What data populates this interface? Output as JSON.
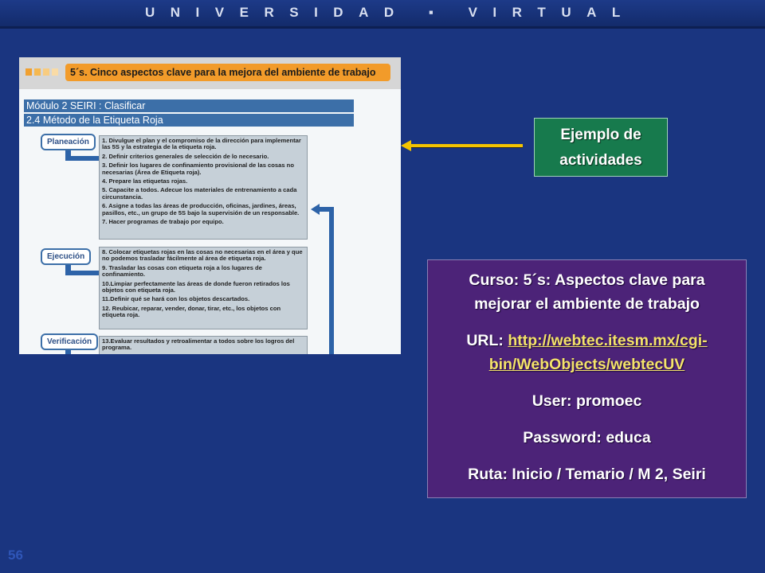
{
  "header": {
    "title": "UNIVERSIDAD ▪ VIRTUAL"
  },
  "slide_number": "56",
  "screenshot": {
    "banner": "5´s. Cinco aspectos clave para la mejora del ambiente de trabajo",
    "module": "Módulo 2 SEIRI : Clasificar",
    "section": "2.4 Método de la Etiqueta Roja",
    "phases": [
      {
        "label": "Planeación",
        "items": [
          "1. Divulgue el plan y el compromiso de la dirección para implementar las 5S y la estrategia de la etiqueta roja.",
          "2. Definir criterios generales de selección de lo necesario.",
          "3. Definir los lugares de confinamiento provisional de las cosas no necesarias (Área de Etiqueta roja).",
          "4. Prepare las etiquetas rojas.",
          "5. Capacite a todos.  Adecue los materiales de entrenamiento a cada circunstancia.",
          "6. Asigne a todas las áreas de producción, oficinas, jardines, áreas, pasillos, etc., un grupo de 5S bajo la supervisión de un responsable.",
          "7. Hacer programas de trabajo por equipo."
        ]
      },
      {
        "label": "Ejecución",
        "items": [
          "8. Colocar etiquetas rojas en las cosas no necesarias en el área y que no podemos trasladar fácilmente al área de etiqueta roja.",
          "9. Trasladar las cosas con etiqueta roja a los lugares de confinamiento.",
          "10.Limpiar perfectamente las áreas de donde fueron retirados los objetos con etiqueta roja.",
          "11.Definir qué se hará con los objetos descartados.",
          "12. Reubicar, reparar, vender, donar, tirar, etc., los objetos con etiqueta roja."
        ]
      },
      {
        "label": "Verificación",
        "items": [
          "13.Evaluar resultados y retroalimentar a todos sobre los logros del programa."
        ]
      }
    ]
  },
  "callout": {
    "line1": "Ejemplo de",
    "line2": "actividades"
  },
  "info": {
    "course_line1": "Curso: 5´s: Aspectos clave para",
    "course_line2": "mejorar el ambiente de trabajo",
    "url_label": "URL: ",
    "url_part1": "http://webtec.itesm.mx/cgi-",
    "url_part2": "bin/WebObjects/webtecUV",
    "user": "User: promoec",
    "password": "Password: educa",
    "route": "Ruta: Inicio / Temario / M 2, Seiri"
  },
  "colors": {
    "background": "#1a3580",
    "callout": "#177a4d",
    "info_box": "#4c2378",
    "arrow": "#f4c400",
    "banner": "#f29b2a"
  }
}
